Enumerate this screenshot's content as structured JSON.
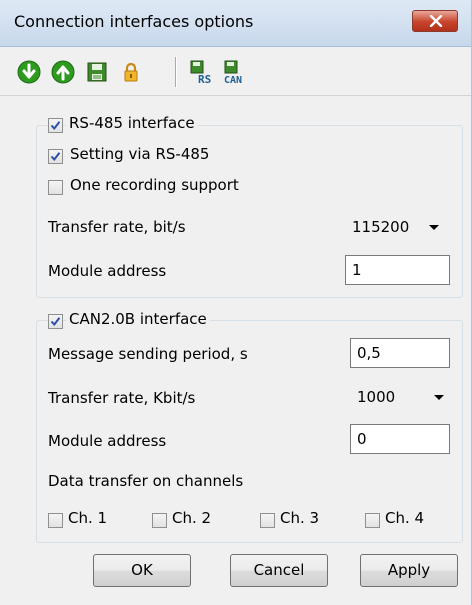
{
  "window": {
    "title": "Connection interfaces options"
  },
  "toolbar": {
    "icons": [
      "down-arrow-icon",
      "up-arrow-icon",
      "save-disk-icon",
      "lock-icon",
      "rs-export-icon",
      "can-export-icon"
    ],
    "rs_label": "RS",
    "can_label": "CAN"
  },
  "rs485": {
    "enabled_label": "RS-485 interface",
    "enabled": true,
    "setting_via_label": "Setting via RS-485",
    "setting_via": true,
    "one_recording_label": "One recording support",
    "one_recording": false,
    "transfer_rate_label": "Transfer rate, bit/s",
    "transfer_rate_value": "115200",
    "module_address_label": "Module address",
    "module_address_value": "1"
  },
  "can": {
    "enabled_label": "CAN2.0B interface",
    "enabled": true,
    "message_period_label": "Message sending period, s",
    "message_period_value": "0,5",
    "transfer_rate_label": "Transfer rate, Kbit/s",
    "transfer_rate_value": "1000",
    "module_address_label": "Module address",
    "module_address_value": "0",
    "channels_label": "Data transfer on channels",
    "channels": [
      {
        "label": "Ch. 1",
        "checked": false
      },
      {
        "label": "Ch. 2",
        "checked": false
      },
      {
        "label": "Ch. 3",
        "checked": false
      },
      {
        "label": "Ch. 4",
        "checked": false
      }
    ]
  },
  "buttons": {
    "ok": "OK",
    "cancel": "Cancel",
    "apply": "Apply"
  },
  "colors": {
    "close_button": "#c7432b",
    "titlebar": "#c7d8ec",
    "check_mark": "#2b4ea8",
    "icon_green": "#2e9a1f"
  }
}
